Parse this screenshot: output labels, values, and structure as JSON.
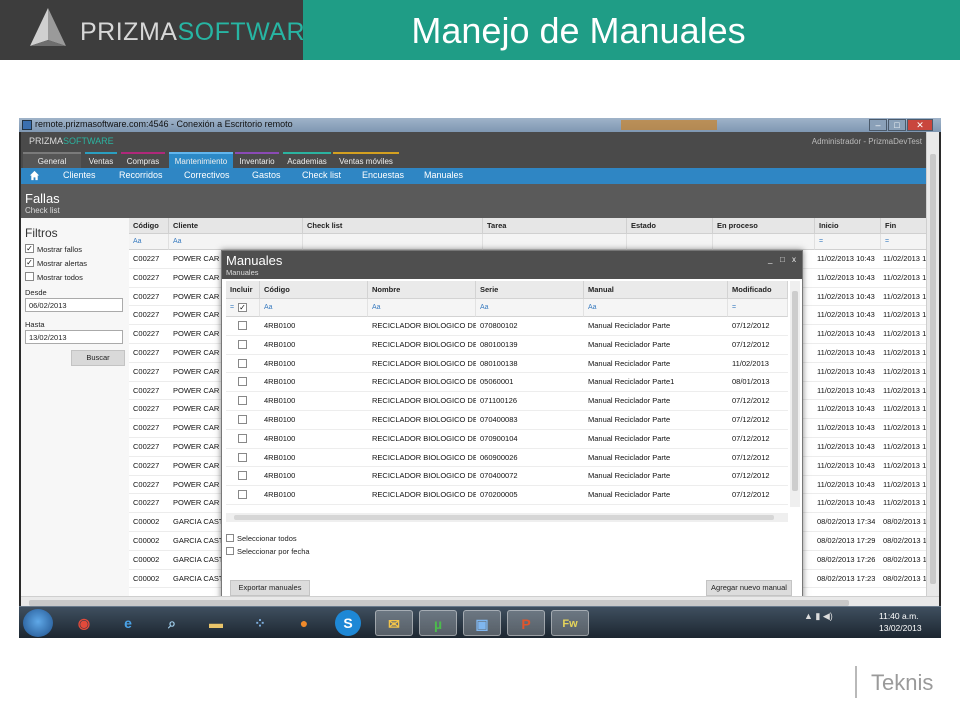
{
  "slide": {
    "brand_prefix": "PRIZMA",
    "brand_suffix": "SOFTWARE",
    "title": "Manejo de Manuales",
    "footer_brand": "Teknis"
  },
  "window": {
    "title": "remote.prizmasoftware.com:4546 - Conexión a Escritorio remoto",
    "btn_min": "–",
    "btn_max": "□",
    "btn_close": "✕"
  },
  "app": {
    "logo_prefix": "PRIZMA",
    "logo_suffix": "SOFTWARE",
    "user": "Administrador - PrizmaDevTest",
    "tabs": [
      "General",
      "Ventas",
      "Compras",
      "Mantenimiento",
      "Inventario",
      "Academias",
      "Ventas móviles"
    ],
    "subnav": [
      "Clientes",
      "Recorridos",
      "Correctivos",
      "Gastos",
      "Check list",
      "Encuestas",
      "Manuales"
    ],
    "page_title": "Fallas",
    "page_subtitle": "Check list"
  },
  "filters": {
    "title": "Filtros",
    "mostrar_fallos": "Mostrar fallos",
    "mostrar_alertas": "Mostrar alertas",
    "mostrar_todos": "Mostrar todos",
    "desde_label": "Desde",
    "desde_value": "06/02/2013",
    "hasta_label": "Hasta",
    "hasta_value": "13/02/2013",
    "buscar": "Buscar",
    "check_mark": "✓"
  },
  "grid": {
    "headers": [
      "Código",
      "Cliente",
      "Check list",
      "Tarea",
      "Estado",
      "En proceso",
      "Inicio",
      "Fin"
    ],
    "filter_text": "Aa",
    "filter_eq": "=",
    "rows": [
      {
        "codigo": "C00227",
        "cliente": "POWER CAR",
        "inicio": "11/02/2013 10:43",
        "fin": "11/02/2013 1"
      },
      {
        "codigo": "C00227",
        "cliente": "POWER CAR",
        "inicio": "11/02/2013 10:43",
        "fin": "11/02/2013 1"
      },
      {
        "codigo": "C00227",
        "cliente": "POWER CAR",
        "inicio": "11/02/2013 10:43",
        "fin": "11/02/2013 1"
      },
      {
        "codigo": "C00227",
        "cliente": "POWER CAR",
        "inicio": "11/02/2013 10:43",
        "fin": "11/02/2013 1"
      },
      {
        "codigo": "C00227",
        "cliente": "POWER CAR",
        "inicio": "11/02/2013 10:43",
        "fin": "11/02/2013 1"
      },
      {
        "codigo": "C00227",
        "cliente": "POWER CAR",
        "inicio": "11/02/2013 10:43",
        "fin": "11/02/2013 1"
      },
      {
        "codigo": "C00227",
        "cliente": "POWER CAR",
        "inicio": "11/02/2013 10:43",
        "fin": "11/02/2013 1"
      },
      {
        "codigo": "C00227",
        "cliente": "POWER CAR",
        "inicio": "11/02/2013 10:43",
        "fin": "11/02/2013 1"
      },
      {
        "codigo": "C00227",
        "cliente": "POWER CAR",
        "inicio": "11/02/2013 10:43",
        "fin": "11/02/2013 1"
      },
      {
        "codigo": "C00227",
        "cliente": "POWER CAR",
        "inicio": "11/02/2013 10:43",
        "fin": "11/02/2013 1"
      },
      {
        "codigo": "C00227",
        "cliente": "POWER CAR",
        "inicio": "11/02/2013 10:43",
        "fin": "11/02/2013 1"
      },
      {
        "codigo": "C00227",
        "cliente": "POWER CAR",
        "inicio": "11/02/2013 10:43",
        "fin": "11/02/2013 1"
      },
      {
        "codigo": "C00227",
        "cliente": "POWER CAR",
        "inicio": "11/02/2013 10:43",
        "fin": "11/02/2013 1"
      },
      {
        "codigo": "C00227",
        "cliente": "POWER CAR",
        "inicio": "11/02/2013 10:43",
        "fin": "11/02/2013 1"
      },
      {
        "codigo": "C00002",
        "cliente": "GARCIA CAST",
        "inicio": "08/02/2013 17:34",
        "fin": "08/02/2013 17"
      },
      {
        "codigo": "C00002",
        "cliente": "GARCIA CAST",
        "inicio": "08/02/2013 17:29",
        "fin": "08/02/2013 17"
      },
      {
        "codigo": "C00002",
        "cliente": "GARCIA CAST",
        "inicio": "08/02/2013 17:26",
        "fin": "08/02/2013 17"
      },
      {
        "codigo": "C00002",
        "cliente": "GARCIA CAST",
        "inicio": "08/02/2013 17:23",
        "fin": "08/02/2013 17"
      }
    ]
  },
  "modal": {
    "title": "Manuales",
    "subtitle": "Manuales",
    "ctl_min": "_",
    "ctl_max": "□",
    "ctl_close": "x",
    "headers": [
      "Incluir",
      "Código",
      "Nombre",
      "Serie",
      "Manual",
      "Modificado"
    ],
    "filter_text": "Aa",
    "filter_eq": "=",
    "rows": [
      {
        "codigo": "4RB0100",
        "nombre": "RECICLADOR BIOLOGICO DE",
        "serie": "070800102",
        "manual": "Manual Reciclador Parte",
        "modificado": "07/12/2012"
      },
      {
        "codigo": "4RB0100",
        "nombre": "RECICLADOR BIOLOGICO DE",
        "serie": "080100139",
        "manual": "Manual Reciclador Parte",
        "modificado": "07/12/2012"
      },
      {
        "codigo": "4RB0100",
        "nombre": "RECICLADOR BIOLOGICO DE",
        "serie": "080100138",
        "manual": "Manual Reciclador Parte",
        "modificado": "11/02/2013"
      },
      {
        "codigo": "4RB0100",
        "nombre": "RECICLADOR BIOLOGICO DE",
        "serie": "05060001",
        "manual": "Manual Reciclador Parte1",
        "modificado": "08/01/2013"
      },
      {
        "codigo": "4RB0100",
        "nombre": "RECICLADOR BIOLOGICO DE",
        "serie": "071100126",
        "manual": "Manual Reciclador Parte",
        "modificado": "07/12/2012"
      },
      {
        "codigo": "4RB0100",
        "nombre": "RECICLADOR BIOLOGICO DE",
        "serie": "070400083",
        "manual": "Manual Reciclador Parte",
        "modificado": "07/12/2012"
      },
      {
        "codigo": "4RB0100",
        "nombre": "RECICLADOR BIOLOGICO DE",
        "serie": "070900104",
        "manual": "Manual Reciclador Parte",
        "modificado": "07/12/2012"
      },
      {
        "codigo": "4RB0100",
        "nombre": "RECICLADOR BIOLOGICO DE",
        "serie": "060900026",
        "manual": "Manual Reciclador Parte",
        "modificado": "07/12/2012"
      },
      {
        "codigo": "4RB0100",
        "nombre": "RECICLADOR BIOLOGICO DE",
        "serie": "070400072",
        "manual": "Manual Reciclador Parte",
        "modificado": "07/12/2012"
      },
      {
        "codigo": "4RB0100",
        "nombre": "RECICLADOR BIOLOGICO DE",
        "serie": "070200005",
        "manual": "Manual Reciclador Parte",
        "modificado": "07/12/2012"
      }
    ],
    "select_all": "Seleccionar todos",
    "select_by_date": "Seleccionar por fecha",
    "export_btn": "Exportar manuales",
    "add_btn": "Agregar nuevo manual"
  },
  "taskbar": {
    "apps": [
      "chrome",
      "internet-explorer",
      "search",
      "folder",
      "network",
      "firefox",
      "skype",
      "outlook",
      "utorrent",
      "remote-desktop",
      "powerpoint",
      "fireworks"
    ],
    "tray": "▲  ▮ ◀)",
    "time": "11:40 a.m.",
    "date": "13/02/2013"
  }
}
